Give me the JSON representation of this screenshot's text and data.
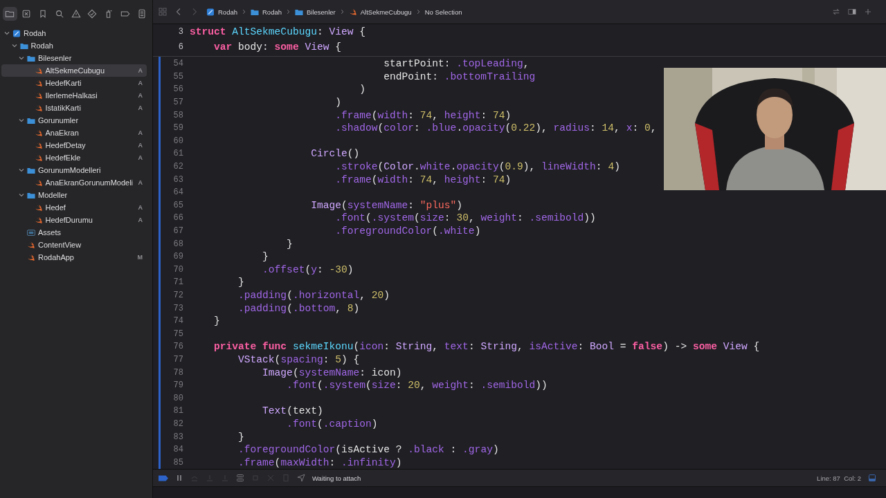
{
  "navigator": {
    "toolbar": [
      {
        "kind": "folder",
        "selected": true
      },
      {
        "kind": "xbox",
        "selected": false
      },
      {
        "kind": "bookmark",
        "selected": false
      },
      {
        "kind": "search",
        "selected": false
      },
      {
        "kind": "warning",
        "selected": false
      },
      {
        "kind": "diamond",
        "selected": false
      },
      {
        "kind": "spray",
        "selected": false
      },
      {
        "kind": "tag",
        "selected": false
      },
      {
        "kind": "report",
        "selected": false
      }
    ],
    "tree": [
      {
        "label": "Rodah",
        "kind": "project",
        "expanded": true,
        "selected": false,
        "children": [
          {
            "label": "Rodah",
            "kind": "folder",
            "expanded": true,
            "selected": false,
            "children": [
              {
                "label": "Bilesenler",
                "kind": "folder",
                "expanded": true,
                "selected": false,
                "children": [
                  {
                    "label": "AltSekmeCubugu",
                    "kind": "swift",
                    "selected": true,
                    "badge": "A"
                  },
                  {
                    "label": "HedefKarti",
                    "kind": "swift",
                    "selected": false,
                    "badge": "A"
                  },
                  {
                    "label": "IlerlemeHalkasi",
                    "kind": "swift",
                    "selected": false,
                    "badge": "A"
                  },
                  {
                    "label": "IstatikKarti",
                    "kind": "swift",
                    "selected": false,
                    "badge": "A"
                  }
                ]
              },
              {
                "label": "Gorunumler",
                "kind": "folder",
                "expanded": true,
                "selected": false,
                "children": [
                  {
                    "label": "AnaEkran",
                    "kind": "swift",
                    "selected": false,
                    "badge": "A"
                  },
                  {
                    "label": "HedefDetay",
                    "kind": "swift",
                    "selected": false,
                    "badge": "A"
                  },
                  {
                    "label": "HedefEkle",
                    "kind": "swift",
                    "selected": false,
                    "badge": "A"
                  }
                ]
              },
              {
                "label": "GorunumModelleri",
                "kind": "folder",
                "expanded": true,
                "selected": false,
                "children": [
                  {
                    "label": "AnaEkranGorunumModeli",
                    "kind": "swift",
                    "selected": false,
                    "badge": "A"
                  }
                ]
              },
              {
                "label": "Modeller",
                "kind": "folder",
                "expanded": true,
                "selected": false,
                "children": [
                  {
                    "label": "Hedef",
                    "kind": "swift",
                    "selected": false,
                    "badge": "A"
                  },
                  {
                    "label": "HedefDurumu",
                    "kind": "swift",
                    "selected": false,
                    "badge": "A"
                  }
                ]
              },
              {
                "label": "Assets",
                "kind": "assets",
                "selected": false
              },
              {
                "label": "ContentView",
                "kind": "swift",
                "selected": false
              },
              {
                "label": "RodahApp",
                "kind": "swift",
                "selected": false,
                "badge": "M"
              }
            ]
          }
        ]
      }
    ]
  },
  "breadcrumb": [
    {
      "label": "Rodah",
      "kind": "project"
    },
    {
      "label": "Rodah",
      "kind": "folder"
    },
    {
      "label": "Bilesenler",
      "kind": "folder"
    },
    {
      "label": "AltSekmeCubugu",
      "kind": "swift"
    },
    {
      "label": "No Selection",
      "kind": "text"
    }
  ],
  "sticky_lines": [
    {
      "number": "3",
      "tokens": [
        {
          "kind": "kw",
          "text": "struct "
        },
        {
          "kind": "decl",
          "text": "AltSekmeCubugu"
        },
        {
          "kind": "p",
          "text": ": "
        },
        {
          "kind": "type",
          "text": "View"
        },
        {
          "kind": "p",
          "text": " {"
        }
      ]
    },
    {
      "number": "6",
      "tokens": [
        {
          "kind": "kw",
          "text": "    var "
        },
        {
          "kind": "p",
          "text": "body: "
        },
        {
          "kind": "kw",
          "text": "some "
        },
        {
          "kind": "type",
          "text": "View"
        },
        {
          "kind": "p",
          "text": " {"
        }
      ]
    }
  ],
  "code_lines": [
    {
      "number": "54",
      "tokens": [
        {
          "kind": "p",
          "text": "                                startPoint: "
        },
        {
          "kind": "fn",
          "text": ".topLeading"
        },
        {
          "kind": "p",
          "text": ","
        }
      ]
    },
    {
      "number": "55",
      "tokens": [
        {
          "kind": "p",
          "text": "                                endPoint: "
        },
        {
          "kind": "fn",
          "text": ".bottomTrailing"
        }
      ]
    },
    {
      "number": "56",
      "tokens": [
        {
          "kind": "p",
          "text": "                            )"
        }
      ]
    },
    {
      "number": "57",
      "tokens": [
        {
          "kind": "p",
          "text": "                        )"
        }
      ]
    },
    {
      "number": "58",
      "tokens": [
        {
          "kind": "fn",
          "text": "                        .frame"
        },
        {
          "kind": "p",
          "text": "("
        },
        {
          "kind": "fn",
          "text": "width"
        },
        {
          "kind": "p",
          "text": ": "
        },
        {
          "kind": "num",
          "text": "74"
        },
        {
          "kind": "p",
          "text": ", "
        },
        {
          "kind": "fn",
          "text": "height"
        },
        {
          "kind": "p",
          "text": ": "
        },
        {
          "kind": "num",
          "text": "74"
        },
        {
          "kind": "p",
          "text": ")"
        }
      ]
    },
    {
      "number": "59",
      "tokens": [
        {
          "kind": "fn",
          "text": "                        .shadow"
        },
        {
          "kind": "p",
          "text": "("
        },
        {
          "kind": "fn",
          "text": "color"
        },
        {
          "kind": "p",
          "text": ": "
        },
        {
          "kind": "fn",
          "text": ".blue"
        },
        {
          "kind": "p",
          "text": "."
        },
        {
          "kind": "fn",
          "text": "opacity"
        },
        {
          "kind": "p",
          "text": "("
        },
        {
          "kind": "num",
          "text": "0.22"
        },
        {
          "kind": "p",
          "text": "), "
        },
        {
          "kind": "fn",
          "text": "radius"
        },
        {
          "kind": "p",
          "text": ": "
        },
        {
          "kind": "num",
          "text": "14"
        },
        {
          "kind": "p",
          "text": ", "
        },
        {
          "kind": "fn",
          "text": "x"
        },
        {
          "kind": "p",
          "text": ": "
        },
        {
          "kind": "num",
          "text": "0"
        },
        {
          "kind": "p",
          "text": ","
        }
      ]
    },
    {
      "number": "60"
    },
    {
      "number": "61",
      "tokens": [
        {
          "kind": "type",
          "text": "                    Circle"
        },
        {
          "kind": "p",
          "text": "()"
        }
      ]
    },
    {
      "number": "62",
      "tokens": [
        {
          "kind": "fn",
          "text": "                        .stroke"
        },
        {
          "kind": "p",
          "text": "("
        },
        {
          "kind": "type",
          "text": "Color"
        },
        {
          "kind": "p",
          "text": "."
        },
        {
          "kind": "fn",
          "text": "white"
        },
        {
          "kind": "p",
          "text": "."
        },
        {
          "kind": "fn",
          "text": "opacity"
        },
        {
          "kind": "p",
          "text": "("
        },
        {
          "kind": "num",
          "text": "0.9"
        },
        {
          "kind": "p",
          "text": "), "
        },
        {
          "kind": "fn",
          "text": "lineWidth"
        },
        {
          "kind": "p",
          "text": ": "
        },
        {
          "kind": "num",
          "text": "4"
        },
        {
          "kind": "p",
          "text": ")"
        }
      ]
    },
    {
      "number": "63",
      "tokens": [
        {
          "kind": "fn",
          "text": "                        .frame"
        },
        {
          "kind": "p",
          "text": "("
        },
        {
          "kind": "fn",
          "text": "width"
        },
        {
          "kind": "p",
          "text": ": "
        },
        {
          "kind": "num",
          "text": "74"
        },
        {
          "kind": "p",
          "text": ", "
        },
        {
          "kind": "fn",
          "text": "height"
        },
        {
          "kind": "p",
          "text": ": "
        },
        {
          "kind": "num",
          "text": "74"
        },
        {
          "kind": "p",
          "text": ")"
        }
      ]
    },
    {
      "number": "64"
    },
    {
      "number": "65",
      "tokens": [
        {
          "kind": "type",
          "text": "                    Image"
        },
        {
          "kind": "p",
          "text": "("
        },
        {
          "kind": "fn",
          "text": "systemName"
        },
        {
          "kind": "p",
          "text": ": "
        },
        {
          "kind": "str",
          "text": "\"plus\""
        },
        {
          "kind": "p",
          "text": ")"
        }
      ]
    },
    {
      "number": "66",
      "tokens": [
        {
          "kind": "fn",
          "text": "                        .font"
        },
        {
          "kind": "p",
          "text": "("
        },
        {
          "kind": "fn",
          "text": ".system"
        },
        {
          "kind": "p",
          "text": "("
        },
        {
          "kind": "fn",
          "text": "size"
        },
        {
          "kind": "p",
          "text": ": "
        },
        {
          "kind": "num",
          "text": "30"
        },
        {
          "kind": "p",
          "text": ", "
        },
        {
          "kind": "fn",
          "text": "weight"
        },
        {
          "kind": "p",
          "text": ": "
        },
        {
          "kind": "fn",
          "text": ".semibold"
        },
        {
          "kind": "p",
          "text": "))"
        }
      ]
    },
    {
      "number": "67",
      "tokens": [
        {
          "kind": "fn",
          "text": "                        .foregroundColor"
        },
        {
          "kind": "p",
          "text": "("
        },
        {
          "kind": "fn",
          "text": ".white"
        },
        {
          "kind": "p",
          "text": ")"
        }
      ]
    },
    {
      "number": "68",
      "tokens": [
        {
          "kind": "p",
          "text": "                }"
        }
      ]
    },
    {
      "number": "69",
      "tokens": [
        {
          "kind": "p",
          "text": "            }"
        }
      ]
    },
    {
      "number": "70",
      "tokens": [
        {
          "kind": "fn",
          "text": "            .offset"
        },
        {
          "kind": "p",
          "text": "("
        },
        {
          "kind": "fn",
          "text": "y"
        },
        {
          "kind": "p",
          "text": ": "
        },
        {
          "kind": "num",
          "text": "-30"
        },
        {
          "kind": "p",
          "text": ")"
        }
      ]
    },
    {
      "number": "71",
      "tokens": [
        {
          "kind": "p",
          "text": "        }"
        }
      ]
    },
    {
      "number": "72",
      "tokens": [
        {
          "kind": "fn",
          "text": "        .padding"
        },
        {
          "kind": "p",
          "text": "("
        },
        {
          "kind": "fn",
          "text": ".horizontal"
        },
        {
          "kind": "p",
          "text": ", "
        },
        {
          "kind": "num",
          "text": "20"
        },
        {
          "kind": "p",
          "text": ")"
        }
      ]
    },
    {
      "number": "73",
      "tokens": [
        {
          "kind": "fn",
          "text": "        .padding"
        },
        {
          "kind": "p",
          "text": "("
        },
        {
          "kind": "fn",
          "text": ".bottom"
        },
        {
          "kind": "p",
          "text": ", "
        },
        {
          "kind": "num",
          "text": "8"
        },
        {
          "kind": "p",
          "text": ")"
        }
      ]
    },
    {
      "number": "74",
      "tokens": [
        {
          "kind": "p",
          "text": "    }"
        }
      ]
    },
    {
      "number": "75"
    },
    {
      "number": "76",
      "tokens": [
        {
          "kind": "kw",
          "text": "    private func "
        },
        {
          "kind": "decl",
          "text": "sekmeIkonu"
        },
        {
          "kind": "p",
          "text": "("
        },
        {
          "kind": "fn",
          "text": "icon"
        },
        {
          "kind": "p",
          "text": ": "
        },
        {
          "kind": "type",
          "text": "String"
        },
        {
          "kind": "p",
          "text": ", "
        },
        {
          "kind": "fn",
          "text": "text"
        },
        {
          "kind": "p",
          "text": ": "
        },
        {
          "kind": "type",
          "text": "String"
        },
        {
          "kind": "p",
          "text": ", "
        },
        {
          "kind": "fn",
          "text": "isActive"
        },
        {
          "kind": "p",
          "text": ": "
        },
        {
          "kind": "type",
          "text": "Bool"
        },
        {
          "kind": "p",
          "text": " = "
        },
        {
          "kind": "kw",
          "text": "false"
        },
        {
          "kind": "p",
          "text": ") -> "
        },
        {
          "kind": "kw",
          "text": "some "
        },
        {
          "kind": "type",
          "text": "View"
        },
        {
          "kind": "p",
          "text": " {"
        }
      ]
    },
    {
      "number": "77",
      "tokens": [
        {
          "kind": "type",
          "text": "        VStack"
        },
        {
          "kind": "p",
          "text": "("
        },
        {
          "kind": "fn",
          "text": "spacing"
        },
        {
          "kind": "p",
          "text": ": "
        },
        {
          "kind": "num",
          "text": "5"
        },
        {
          "kind": "p",
          "text": ") {"
        }
      ]
    },
    {
      "number": "78",
      "tokens": [
        {
          "kind": "type",
          "text": "            Image"
        },
        {
          "kind": "p",
          "text": "("
        },
        {
          "kind": "fn",
          "text": "systemName"
        },
        {
          "kind": "p",
          "text": ": icon)"
        }
      ]
    },
    {
      "number": "79",
      "tokens": [
        {
          "kind": "fn",
          "text": "                .font"
        },
        {
          "kind": "p",
          "text": "("
        },
        {
          "kind": "fn",
          "text": ".system"
        },
        {
          "kind": "p",
          "text": "("
        },
        {
          "kind": "fn",
          "text": "size"
        },
        {
          "kind": "p",
          "text": ": "
        },
        {
          "kind": "num",
          "text": "20"
        },
        {
          "kind": "p",
          "text": ", "
        },
        {
          "kind": "fn",
          "text": "weight"
        },
        {
          "kind": "p",
          "text": ": "
        },
        {
          "kind": "fn",
          "text": ".semibold"
        },
        {
          "kind": "p",
          "text": "))"
        }
      ]
    },
    {
      "number": "80"
    },
    {
      "number": "81",
      "tokens": [
        {
          "kind": "type",
          "text": "            Text"
        },
        {
          "kind": "p",
          "text": "(text)"
        }
      ]
    },
    {
      "number": "82",
      "tokens": [
        {
          "kind": "fn",
          "text": "                .font"
        },
        {
          "kind": "p",
          "text": "("
        },
        {
          "kind": "fn",
          "text": ".caption"
        },
        {
          "kind": "p",
          "text": ")"
        }
      ]
    },
    {
      "number": "83",
      "tokens": [
        {
          "kind": "p",
          "text": "        }"
        }
      ]
    },
    {
      "number": "84",
      "tokens": [
        {
          "kind": "fn",
          "text": "        .foregroundColor"
        },
        {
          "kind": "p",
          "text": "(isActive ? "
        },
        {
          "kind": "fn",
          "text": ".black"
        },
        {
          "kind": "p",
          "text": " : "
        },
        {
          "kind": "fn",
          "text": ".gray"
        },
        {
          "kind": "p",
          "text": ")"
        }
      ]
    },
    {
      "number": "85",
      "tokens": [
        {
          "kind": "fn",
          "text": "        .frame"
        },
        {
          "kind": "p",
          "text": "("
        },
        {
          "kind": "fn",
          "text": "maxWidth"
        },
        {
          "kind": "p",
          "text": ": "
        },
        {
          "kind": "fn",
          "text": ".infinity"
        },
        {
          "kind": "p",
          "text": ")"
        }
      ]
    }
  ],
  "debug_bar": {
    "status": "Waiting to attach",
    "position": "Line: 87  Col: 2"
  }
}
